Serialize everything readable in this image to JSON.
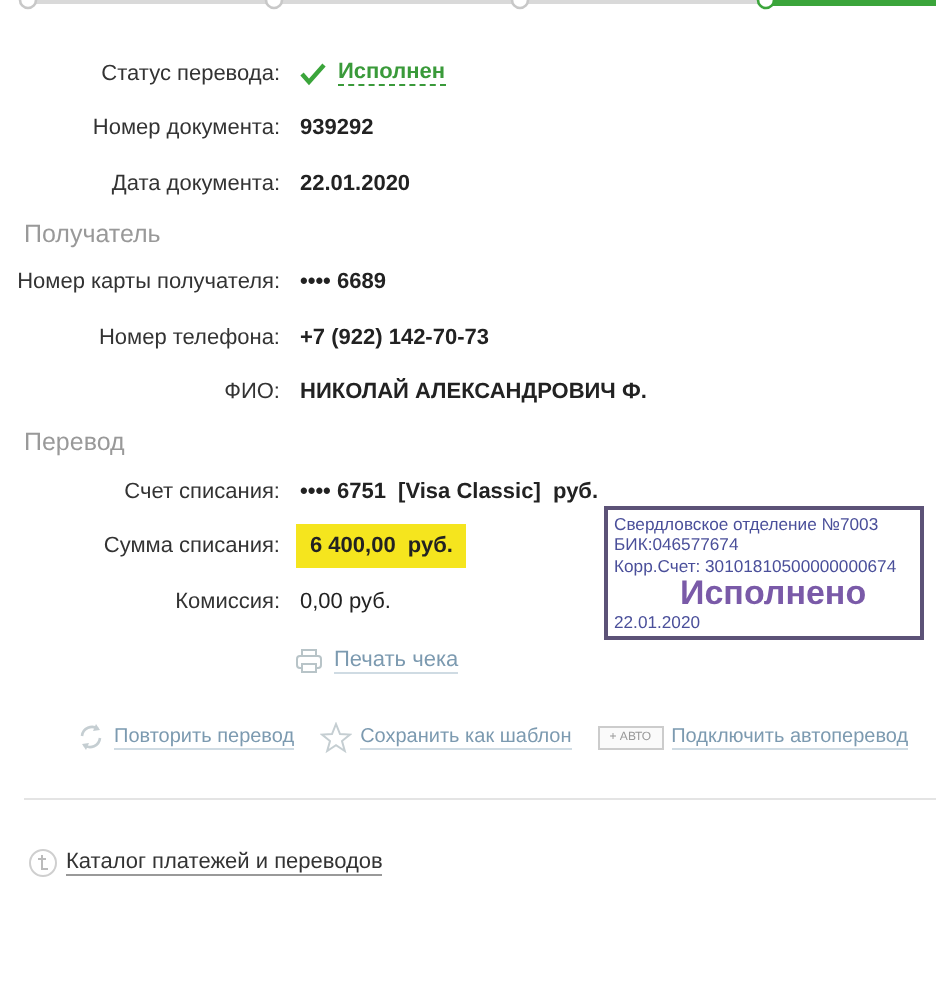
{
  "steps": [
    {
      "selected": false
    },
    {
      "selected": false
    },
    {
      "selected": false
    },
    {
      "selected": true
    }
  ],
  "details": [
    {
      "label": "Статус перевода:",
      "value": "Исполнен",
      "kind": "status"
    },
    {
      "label": "Номер документа:",
      "value": "939292",
      "kind": "bold"
    },
    {
      "label": "Дата документа:",
      "value": "22.01.2020",
      "kind": "bold"
    }
  ],
  "recipient": {
    "title": "Получатель",
    "rows": [
      {
        "label": "Номер карты получателя:",
        "value": "•••• 6689",
        "kind": "bold"
      },
      {
        "label": "Номер телефона:",
        "value": "+7 (922) 142-70-73",
        "kind": "bold"
      },
      {
        "label": "ФИО:",
        "value": "НИКОЛАЙ АЛЕКСАНДРОВИЧ Ф.",
        "kind": "bold"
      }
    ]
  },
  "transfer": {
    "title": "Перевод",
    "rows": [
      {
        "label": "Счет списания:",
        "value": "•••• 6751  [Visa Classic]  руб.",
        "kind": "bold"
      },
      {
        "label": "Сумма списания:",
        "value": "6 400,00  руб.",
        "kind": "amount"
      },
      {
        "label": "Комиссия:",
        "value": "0,00 руб.",
        "kind": "plain"
      }
    ]
  },
  "print_link": "Печать чека",
  "stamp": {
    "lines": [
      "Свердловское отделение №7003",
      "БИК:046577674",
      "Корр.Счет: 30101810500000000674"
    ],
    "status": "Исполнено",
    "date": "22.01.2020"
  },
  "actions": [
    {
      "label": "Повторить перевод",
      "kind": "repeat"
    },
    {
      "label": "Сохранить как шаблон",
      "kind": "star"
    },
    {
      "label": "Подключить автоперевод",
      "kind": "auto",
      "badge": "+ АВТО"
    }
  ],
  "catalog_link": "Каталог платежей и переводов"
}
